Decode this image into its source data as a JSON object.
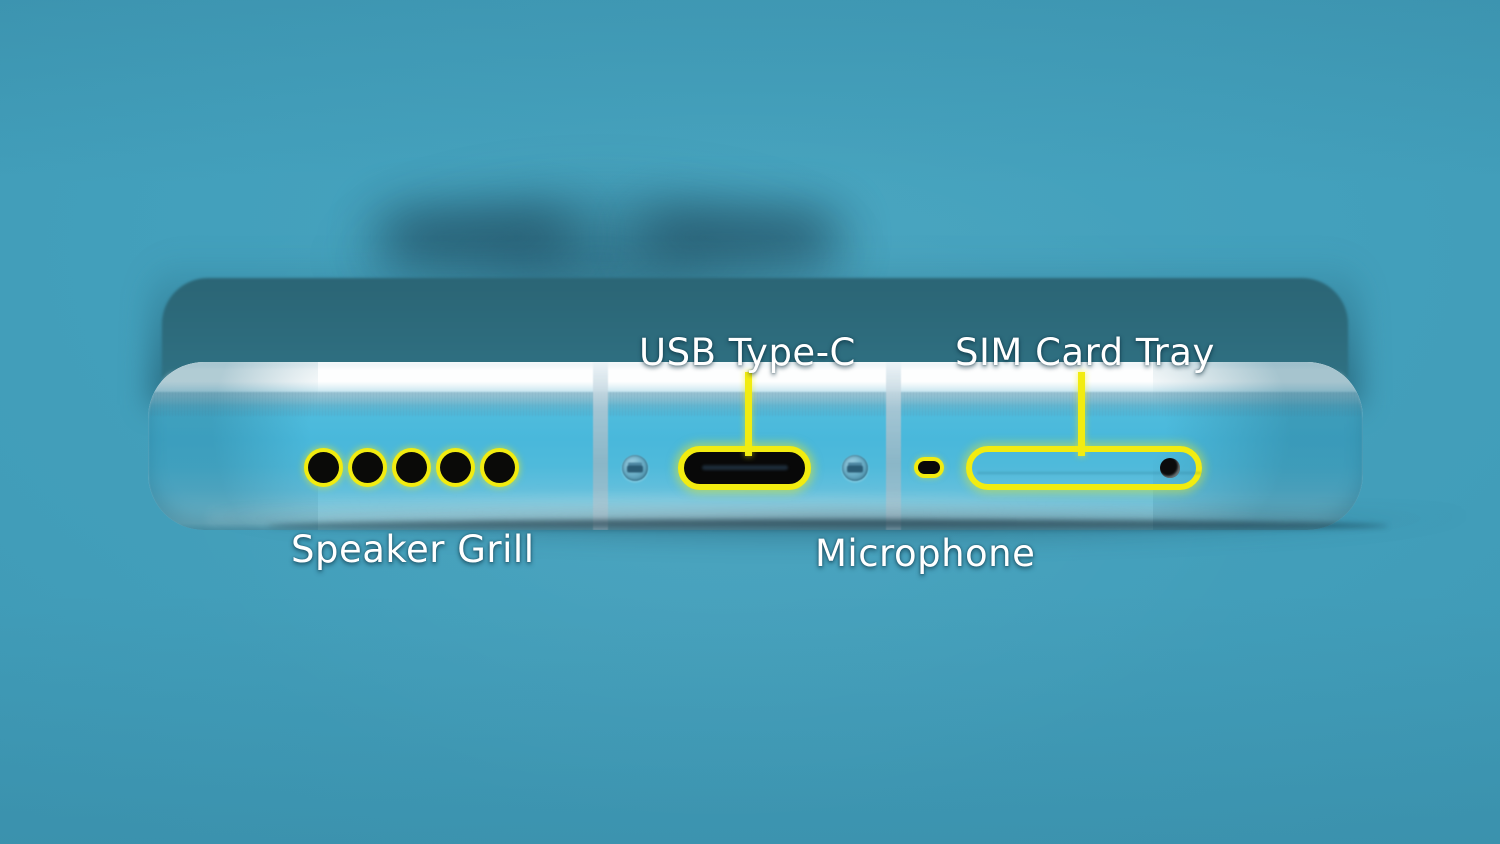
{
  "scene": {
    "title": "Smartphone bottom edge annotated diagram",
    "background_color": "#43a0bc",
    "highlight_color": "#f2ec10",
    "label_color": "#ffffff",
    "phone_frame_color": "#49b8db",
    "phone_back_color": "#2d6b7c"
  },
  "annotations": [
    {
      "id": "speaker-grill",
      "label": "Speaker Grill",
      "position": "below",
      "has_leader_line": false,
      "highlight_shape": "five-circles",
      "hole_count": 5
    },
    {
      "id": "usb-type-c",
      "label": "USB Type-C",
      "position": "above",
      "has_leader_line": true,
      "highlight_shape": "rounded-rect-filled"
    },
    {
      "id": "microphone",
      "label": "Microphone",
      "position": "below",
      "has_leader_line": false,
      "highlight_shape": "small-oval"
    },
    {
      "id": "sim-card-tray",
      "label": "SIM Card Tray",
      "position": "above",
      "has_leader_line": true,
      "highlight_shape": "rounded-rect-outline"
    }
  ],
  "labels": {
    "usb_type_c": "USB Type-C",
    "sim_card_tray": "SIM Card Tray",
    "speaker_grill": "Speaker Grill",
    "microphone": "Microphone"
  },
  "hardware": {
    "screw_count": 2,
    "antenna_line_count": 2,
    "sim_pinhole": true
  }
}
